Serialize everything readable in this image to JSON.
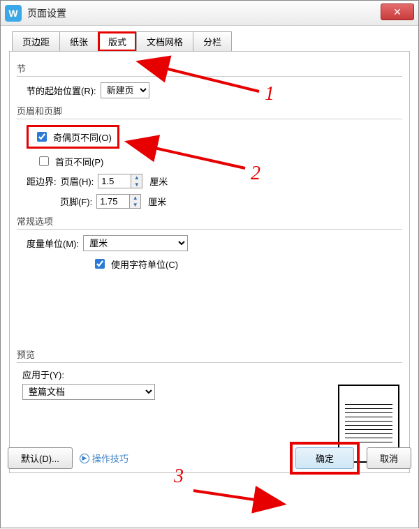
{
  "window": {
    "title": "页面设置"
  },
  "tabs": [
    {
      "label": "页边距"
    },
    {
      "label": "纸张"
    },
    {
      "label": "版式"
    },
    {
      "label": "文档网格"
    },
    {
      "label": "分栏"
    }
  ],
  "section": {
    "group_label": "节",
    "start_label": "节的起始位置(R):",
    "start_value": "新建页"
  },
  "headerfooter": {
    "group_label": "页眉和页脚",
    "odd_even_label": "奇偶页不同(O)",
    "odd_even_checked": true,
    "first_page_label": "首页不同(P)",
    "first_page_checked": false,
    "margin_label": "距边界:",
    "header_label": "页眉(H):",
    "header_value": "1.5",
    "header_unit": "厘米",
    "footer_label": "页脚(F):",
    "footer_value": "1.75",
    "footer_unit": "厘米"
  },
  "general": {
    "group_label": "常规选项",
    "unit_label": "度量单位(M):",
    "unit_value": "厘米",
    "use_char_label": "使用字符单位(C)",
    "use_char_checked": true
  },
  "preview": {
    "group_label": "预览",
    "apply_label": "应用于(Y):",
    "apply_value": "整篇文档"
  },
  "footer_buttons": {
    "default": "默认(D)...",
    "tips": "操作技巧",
    "ok": "确定",
    "cancel": "取消"
  },
  "annotations": {
    "n1": "1",
    "n2": "2",
    "n3": "3"
  }
}
